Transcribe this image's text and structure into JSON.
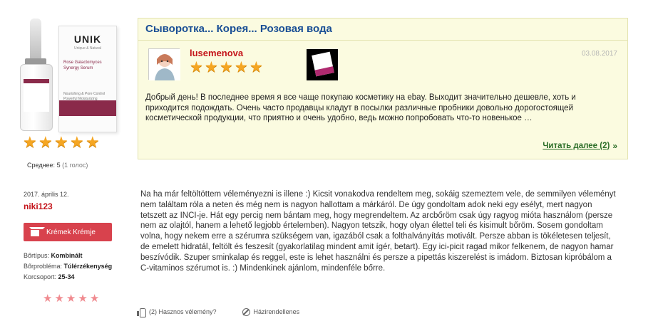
{
  "product": {
    "brand": "UNIK",
    "brand_sub": "Unique & Natural",
    "name": "Rose Galactomyces Synergy Serum",
    "description": "Nourishing & Pore Control Powerful Moisturizing Whitening & Wrinkle Care",
    "rating_stars": 5,
    "average_label": "Среднее:",
    "average_value": "5",
    "votes": "(1 голос)"
  },
  "top_review": {
    "title": "Сыворотка... Корея... Розовая вода",
    "author": "lusemenova",
    "rating_stars": 5,
    "date": "03.08.2017",
    "text": "Добрый день! В последнее время я все чаще покупаю косметику на ebay. Выходит значительно дешевле, хоть и приходится подождать. Очень часто продавцы кладут в посылки различные пробники довольно дорогостоящей косметической продукции, что приятно и очень удобно, ведь можно попробовать что-то новенькое …",
    "read_more": "Читать далее (2)",
    "read_more_arrow": "»"
  },
  "review2": {
    "date": "2017. április 12.",
    "author": "niki123",
    "badge_label": "Krémek Krémje",
    "attributes": [
      {
        "key": "Bőrtípus:",
        "value": "Kombinált"
      },
      {
        "key": "Bőrprobléma:",
        "value": "Túlérzékenység"
      },
      {
        "key": "Korcsoport:",
        "value": "25-34"
      }
    ],
    "rating_stars": 5,
    "text": "Na ha már feltöltöttem véleményezni is illene :) Kicsit vonakodva rendeltem meg, sokáig szemeztem vele, de semmilyen véleményt nem találtam róla a neten és még nem is nagyon hallottam a márkáról. De úgy gondoltam adok neki egy esélyt, mert nagyon tetszett az INCI-je. Hát egy percig nem bántam meg, hogy megrendeltem. Az arcbőröm csak úgy ragyog mióta használom (persze nem az olajtól, hanem a lehető legjobb értelemben). Nagyon tetszik, hogy olyan élettel teli és kisimult bőröm. Sosem gondoltam volna, hogy nekem erre a szérumra szükségem van, igazából csak a folthalványítás motivált. Persze abban is tökéletesen teljesít, de emelett hidratál, feltölt és feszesít (gyakorlatilag mindent amit ígér, betart). Egy ici-picit ragad mikor felkenem, de nagyon hamar beszívódik. Szuper sminkalap és reggel, este is lehet használni és persze a pipettás kiszerelést is imádom. Biztosan kipróbálom a C-vitaminos szérumot is. :) Mindenkinek ajánlom, mindenféle bőrre.",
    "helpful_label": "(2) Hasznos vélemény?",
    "report_label": "Házirendellenes"
  },
  "colors": {
    "card_bg": "#fbfbe0",
    "title_blue": "#1a4f95",
    "author_red": "#c4141a",
    "badge_red": "#d8424d",
    "link_green": "#2c6e28",
    "star_gold": "#f5a623",
    "star_pink": "#f08a8f"
  }
}
